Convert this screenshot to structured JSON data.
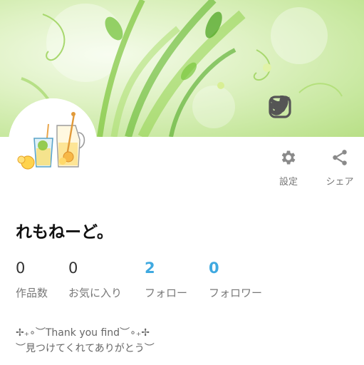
{
  "profile": {
    "display_name": "れもねーど。",
    "bio_line1": "✢₊∘︶Thank you find︶∘₊✢",
    "bio_line2": "︶見つけてくれてありがとう︶"
  },
  "actions": {
    "settings_label": "設定",
    "share_label": "シェア"
  },
  "social": [
    "twitter-icon",
    "tiktok-icon",
    "instagram-icon"
  ],
  "stats": [
    {
      "value": "0",
      "label": "作品数"
    },
    {
      "value": "0",
      "label": "お気に入り"
    },
    {
      "value": "2",
      "label": "フォロー"
    },
    {
      "value": "0",
      "label": "フォロワー"
    }
  ],
  "colors": {
    "accent": "#3fa9e0",
    "icon_gray": "#777777",
    "banner_green": "#b8df86"
  }
}
